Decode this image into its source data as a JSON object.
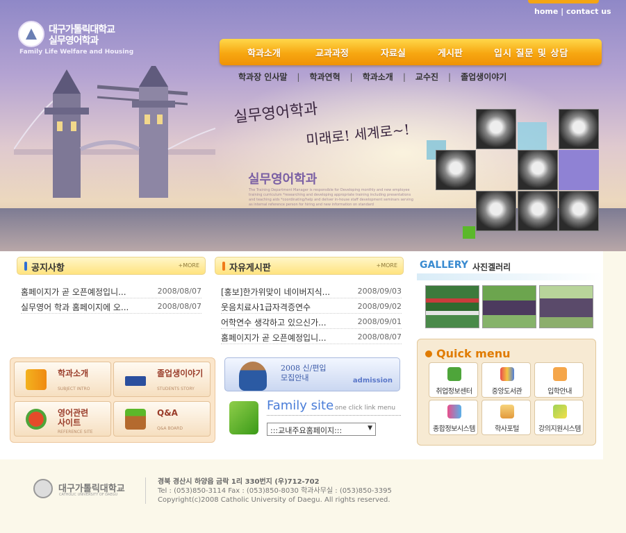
{
  "header": {
    "top_links": [
      "home",
      "contact us"
    ],
    "logo": {
      "line1": "대구가톨릭대학교",
      "line2": "실무영어학과",
      "line3": "Family Life Welfare and Housing"
    },
    "main_nav": [
      "학과소개",
      "교과과정",
      "자료실",
      "게시판",
      "입시 질문 및 상담"
    ],
    "sub_nav": [
      "학과장 인사말",
      "학과연혁",
      "학과소개",
      "교수진",
      "졸업생이야기"
    ]
  },
  "hero": {
    "slogan_line1": "실무영어학과",
    "slogan_line2": "미래로! 세계로~!",
    "dept_name": "실무영어학과",
    "dept_desc": "The Training Department Manager is responsible for Developing monthly and new employee training curriculum *researching and developing appropriate training including presentations and teaching aids *coordinating/help and deliver in-house staff development seminars serving as internal reference person for hiring and new information on standard"
  },
  "notice": {
    "title": "공지사항",
    "more": "+MORE",
    "items": [
      {
        "title": "홈페이지가 곧 오픈예정입니...",
        "date": "2008/08/07"
      },
      {
        "title": "실무영어 학과 홈페이지에 오...",
        "date": "2008/08/07"
      }
    ]
  },
  "freeboard": {
    "title": "자유게시판",
    "more": "+MORE",
    "items": [
      {
        "title": "[홍보]한가위맞이 네이버지식...",
        "date": "2008/09/03"
      },
      {
        "title": "웃음치료사1급자격증연수",
        "date": "2008/09/02"
      },
      {
        "title": "어학연수 생각하고 있으신가...",
        "date": "2008/09/01"
      },
      {
        "title": "홈페이지가 곧 오픈예정입니...",
        "date": "2008/08/07"
      }
    ]
  },
  "gallery": {
    "title": "GALLERY",
    "subtitle": "사진겔러리"
  },
  "left_menu": [
    {
      "label": "학과소개",
      "sub": "SUBJECT INTRO",
      "icon": "books-icon"
    },
    {
      "label": "졸업생이야기",
      "sub": "STUDENTS STORY",
      "icon": "graduation-cap-icon"
    },
    {
      "label": "영어관련\n사이트",
      "sub": "REFERENCE SITE",
      "icon": "apple-globe-icon"
    },
    {
      "label": "Q&A",
      "sub": "Q&A BOARD",
      "icon": "plant-pot-icon"
    }
  ],
  "admission": {
    "text_line1": "2008 신/편입",
    "text_line2": "모집안내",
    "en": "admission"
  },
  "family_site": {
    "title": "Family site",
    "subtitle": "one click link menu",
    "selected": ":::교내주요홈페이지:::"
  },
  "quick_menu": {
    "title": "Quick menu",
    "items": [
      "취업정보센터",
      "중앙도서관",
      "입학안내",
      "종합정보시스템",
      "학사포털",
      "강의지원시스템"
    ]
  },
  "footer": {
    "name": "대구가톨릭대학교",
    "sub": "CATHOLIC UNIVERSITY OF DAEGU",
    "address": "경북 경산시 하양읍 금락 1리 330번지 (우)712-702",
    "contact": "Tel : (053)850-3114 Fax : (053)850-8030   학과사무실 : (053)850-3395",
    "copyright": "Copyright(c)2008 Catholic University of Daegu. All rights reserved."
  },
  "colors": {
    "nav_orange": "#f7a711",
    "accent_blue": "#2f6fd4",
    "quick_orange": "#e07b00",
    "purple": "#7a5fa4"
  }
}
